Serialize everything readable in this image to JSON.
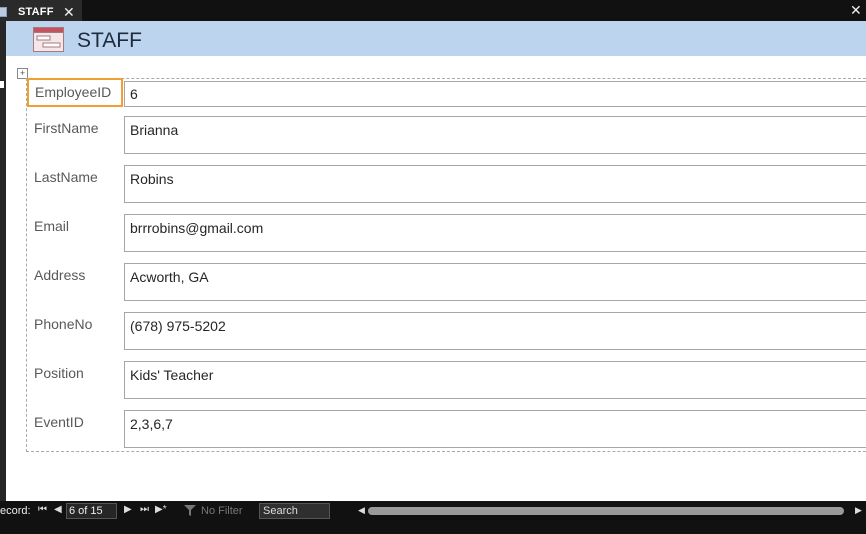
{
  "tab": {
    "title": "STAFF",
    "close_glyph": "✕"
  },
  "window": {
    "close_glyph": "✕"
  },
  "form": {
    "title": "STAFF",
    "icon": "form-icon",
    "fields": [
      {
        "label": "EmployeeID",
        "value": "6"
      },
      {
        "label": "FirstName",
        "value": "Brianna"
      },
      {
        "label": "LastName",
        "value": "Robins"
      },
      {
        "label": "Email",
        "value": "brrrobins@gmail.com"
      },
      {
        "label": "Address",
        "value": "Acworth, GA"
      },
      {
        "label": "PhoneNo",
        "value": "(678) 975-5202"
      },
      {
        "label": "Position",
        "value": "Kids' Teacher"
      },
      {
        "label": "EventID",
        "value": "2,3,6,7"
      }
    ]
  },
  "navigation": {
    "record_label": "ecord:",
    "position": "6 of 15",
    "first": "⏮",
    "prev": "◀",
    "next": "▶",
    "last": "⏭",
    "new": "▶*",
    "filter": "No Filter",
    "search": "Search",
    "scroll_left": "◀",
    "scroll_right": "▶"
  },
  "colors": {
    "header_bg": "#bcd4ee",
    "selected_outline": "#f0a030"
  }
}
